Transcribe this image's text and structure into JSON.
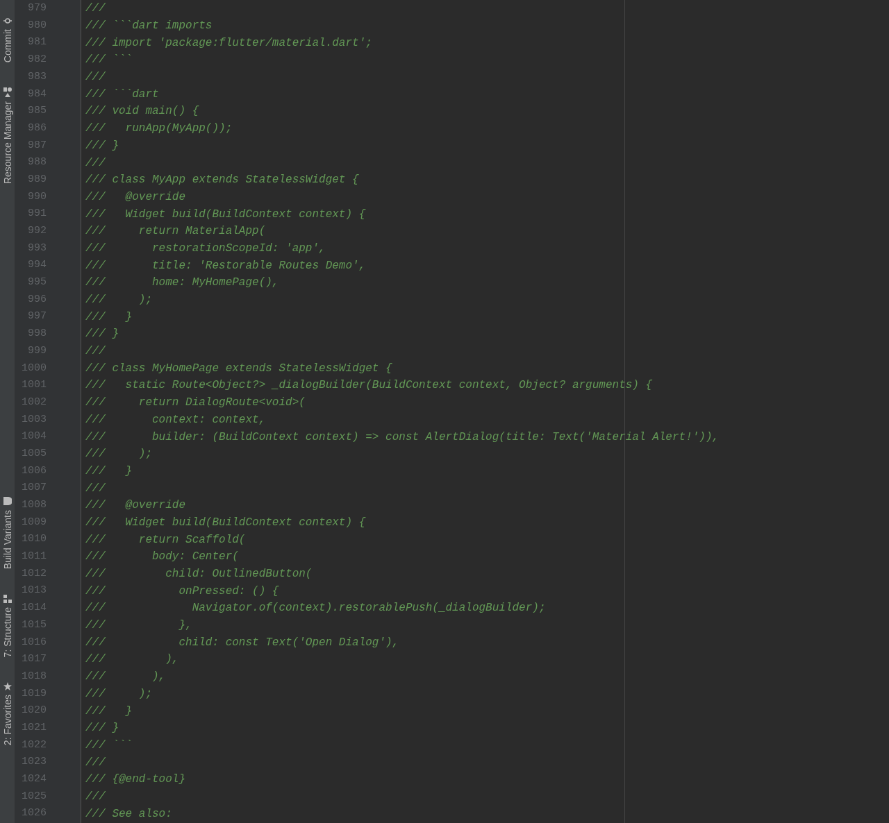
{
  "tool_windows": [
    {
      "kind": "commit",
      "label": "Commit"
    },
    {
      "kind": "resources",
      "label": "Resource Manager"
    },
    {
      "kind": "build-variants",
      "label": "Build Variants"
    },
    {
      "kind": "structure",
      "label": "7: Structure"
    },
    {
      "kind": "favorites",
      "label": "2: Favorites"
    }
  ],
  "lines": [
    {
      "number": "979",
      "text": "///"
    },
    {
      "number": "980",
      "text": "/// ```dart imports"
    },
    {
      "number": "981",
      "text": "/// import 'package:flutter/material.dart';"
    },
    {
      "number": "982",
      "text": "/// ```"
    },
    {
      "number": "983",
      "text": "///"
    },
    {
      "number": "984",
      "text": "/// ```dart"
    },
    {
      "number": "985",
      "text": "/// void main() {"
    },
    {
      "number": "986",
      "text": "///   runApp(MyApp());"
    },
    {
      "number": "987",
      "text": "/// }"
    },
    {
      "number": "988",
      "text": "///"
    },
    {
      "number": "989",
      "text": "/// class MyApp extends StatelessWidget {"
    },
    {
      "number": "990",
      "text": "///   @override"
    },
    {
      "number": "991",
      "text": "///   Widget build(BuildContext context) {"
    },
    {
      "number": "992",
      "text": "///     return MaterialApp("
    },
    {
      "number": "993",
      "text": "///       restorationScopeId: 'app',"
    },
    {
      "number": "994",
      "text": "///       title: 'Restorable Routes Demo',"
    },
    {
      "number": "995",
      "text": "///       home: MyHomePage(),"
    },
    {
      "number": "996",
      "text": "///     );"
    },
    {
      "number": "997",
      "text": "///   }"
    },
    {
      "number": "998",
      "text": "/// }"
    },
    {
      "number": "999",
      "text": "///"
    },
    {
      "number": "1000",
      "text": "/// class MyHomePage extends StatelessWidget {"
    },
    {
      "number": "1001",
      "text": "///   static Route<Object?> _dialogBuilder(BuildContext context, Object? arguments) {"
    },
    {
      "number": "1002",
      "text": "///     return DialogRoute<void>("
    },
    {
      "number": "1003",
      "text": "///       context: context,"
    },
    {
      "number": "1004",
      "text": "///       builder: (BuildContext context) => const AlertDialog(title: Text('Material Alert!')),"
    },
    {
      "number": "1005",
      "text": "///     );"
    },
    {
      "number": "1006",
      "text": "///   }"
    },
    {
      "number": "1007",
      "text": "///"
    },
    {
      "number": "1008",
      "text": "///   @override"
    },
    {
      "number": "1009",
      "text": "///   Widget build(BuildContext context) {"
    },
    {
      "number": "1010",
      "text": "///     return Scaffold("
    },
    {
      "number": "1011",
      "text": "///       body: Center("
    },
    {
      "number": "1012",
      "text": "///         child: OutlinedButton("
    },
    {
      "number": "1013",
      "text": "///           onPressed: () {"
    },
    {
      "number": "1014",
      "text": "///             Navigator.of(context).restorablePush(_dialogBuilder);"
    },
    {
      "number": "1015",
      "text": "///           },"
    },
    {
      "number": "1016",
      "text": "///           child: const Text('Open Dialog'),"
    },
    {
      "number": "1017",
      "text": "///         ),"
    },
    {
      "number": "1018",
      "text": "///       ),"
    },
    {
      "number": "1019",
      "text": "///     );"
    },
    {
      "number": "1020",
      "text": "///   }"
    },
    {
      "number": "1021",
      "text": "/// }"
    },
    {
      "number": "1022",
      "text": "/// ```"
    },
    {
      "number": "1023",
      "text": "///"
    },
    {
      "number": "1024",
      "text": "/// {@end-tool}"
    },
    {
      "number": "1025",
      "text": "///"
    },
    {
      "number": "1026",
      "text": "/// See also:"
    }
  ]
}
